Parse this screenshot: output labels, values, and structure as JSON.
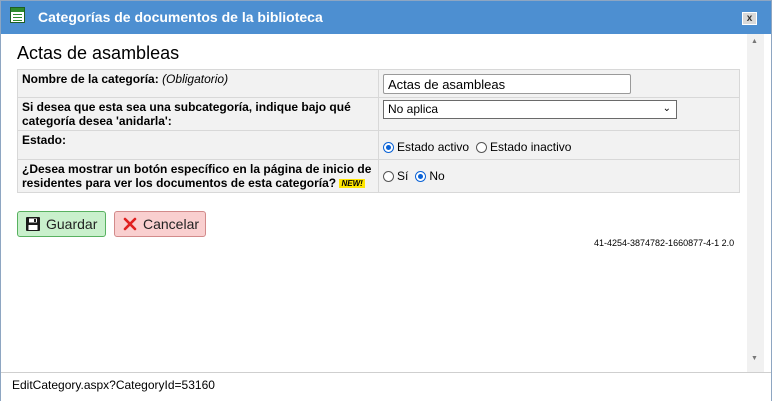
{
  "window": {
    "title": "Categorías de documentos de la biblioteca",
    "close_glyph": "x"
  },
  "page": {
    "heading": "Actas de asambleas"
  },
  "form": {
    "name": {
      "label": "Nombre de la categoría:",
      "hint": "(Obligatorio)",
      "value": "Actas de asambleas"
    },
    "parent": {
      "label": "Si desea que esta sea una subcategoría, indique bajo qué categoría desea 'anidarla':",
      "selected": "No aplica"
    },
    "status": {
      "label": "Estado:",
      "active_label": "Estado activo",
      "inactive_label": "Estado inactivo",
      "selected": "active"
    },
    "button_question": {
      "label": "¿Desea mostrar un botón específico en la página de inicio de residentes para ver los documentos de esta categoría?",
      "badge": "NEW!",
      "yes_label": "Sí",
      "no_label": "No",
      "selected": "no"
    }
  },
  "actions": {
    "save_label": "Guardar",
    "cancel_label": "Cancelar"
  },
  "version": "41-4254-3874782-1660877-4-1 2.0",
  "status_bar": {
    "text": "EditCategory.aspx?CategoryId=53160"
  },
  "icons": {
    "app": "document-list-icon",
    "close": "close-icon",
    "save": "floppy-disk-icon",
    "cancel": "x-icon",
    "dropdown": "chevron-down-icon"
  },
  "colors": {
    "titlebar": "#4d8fd1",
    "save_bg": "#c9f0cc",
    "cancel_bg": "#f9cfcf",
    "radio_checked": "#0a62d6",
    "badge": "#ffe600"
  }
}
